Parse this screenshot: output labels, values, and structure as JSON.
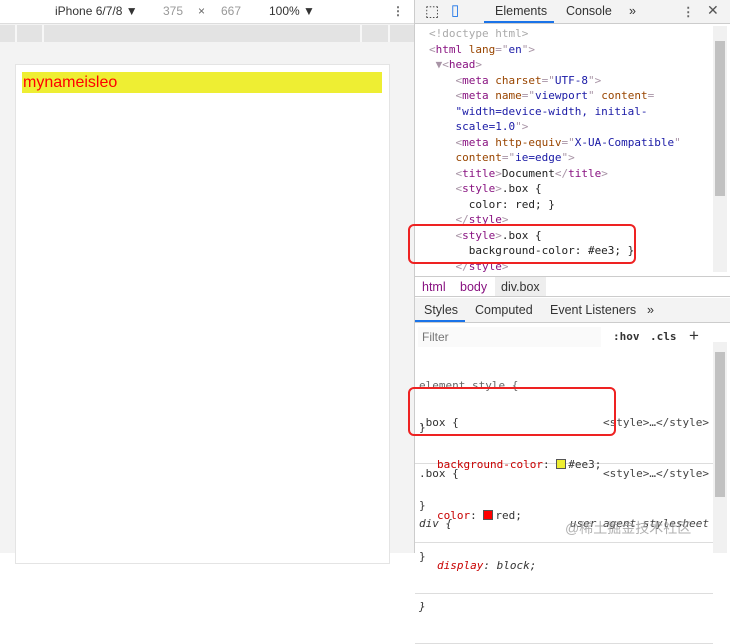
{
  "device_toolbar": {
    "device": "iPhone 6/7/8",
    "width": "375",
    "times": "×",
    "height": "667",
    "zoom": "100%"
  },
  "page": {
    "box_text": "mynameisleo",
    "box_bg": "#eeee33",
    "box_color": "#ff0000"
  },
  "devtools": {
    "tabs": [
      "Elements",
      "Console"
    ],
    "more": "»",
    "tree": [
      [
        [
          "gr",
          "<!doctype html>"
        ]
      ],
      [
        [
          "pn",
          "<"
        ],
        [
          "tg",
          "html"
        ],
        [
          "at",
          " lang"
        ],
        [
          "pn",
          "=\""
        ],
        [
          "av",
          "en"
        ],
        [
          "pn",
          "\">"
        ]
      ],
      [
        [
          "pn",
          " ▼<"
        ],
        [
          "tg",
          "head"
        ],
        [
          "pn",
          ">"
        ]
      ],
      [
        [
          "pn",
          "    <"
        ],
        [
          "tg",
          "meta"
        ],
        [
          "at",
          " charset"
        ],
        [
          "pn",
          "=\""
        ],
        [
          "av",
          "UTF-8"
        ],
        [
          "pn",
          "\">"
        ]
      ],
      [
        [
          "pn",
          "    <"
        ],
        [
          "tg",
          "meta"
        ],
        [
          "at",
          " name"
        ],
        [
          "pn",
          "=\""
        ],
        [
          "av",
          "viewport"
        ],
        [
          "pn",
          "\""
        ],
        [
          "at",
          " content"
        ],
        [
          "pn",
          "="
        ]
      ],
      [
        [
          "av",
          "    \"width=device-width, initial-"
        ]
      ],
      [
        [
          "av",
          "    scale=1.0"
        ],
        [
          "pn",
          "\">"
        ]
      ],
      [
        [
          "pn",
          "    <"
        ],
        [
          "tg",
          "meta"
        ],
        [
          "at",
          " http-equiv"
        ],
        [
          "pn",
          "=\""
        ],
        [
          "av",
          "X-UA-Compatible"
        ],
        [
          "pn",
          "\""
        ]
      ],
      [
        [
          "at",
          "    content"
        ],
        [
          "pn",
          "=\""
        ],
        [
          "av",
          "ie=edge"
        ],
        [
          "pn",
          "\">"
        ]
      ],
      [
        [
          "pn",
          "    <"
        ],
        [
          "tg",
          "title"
        ],
        [
          "pn",
          ">"
        ],
        [
          "tx",
          "Document"
        ],
        [
          "pn",
          "</"
        ],
        [
          "tg",
          "title"
        ],
        [
          "pn",
          ">"
        ]
      ],
      [
        [
          "pn",
          "    <"
        ],
        [
          "tg",
          "style"
        ],
        [
          "pn",
          ">"
        ],
        [
          "tx",
          ".box {"
        ]
      ],
      [
        [
          "tx",
          "      color: red; }"
        ]
      ],
      [
        [
          "pn",
          "    </"
        ],
        [
          "tg",
          "style"
        ],
        [
          "pn",
          ">"
        ]
      ],
      [
        [
          "pn",
          "    <"
        ],
        [
          "tg",
          "style"
        ],
        [
          "pn",
          ">"
        ],
        [
          "tx",
          ".box {"
        ]
      ],
      [
        [
          "tx",
          "      background-color: #ee3; }"
        ]
      ],
      [
        [
          "pn",
          "    </"
        ],
        [
          "tg",
          "style"
        ],
        [
          "pn",
          ">"
        ]
      ]
    ],
    "breadcrumb": [
      "html",
      "body",
      "div.box"
    ],
    "style_tabs": [
      "Styles",
      "Computed",
      "Event Listeners"
    ],
    "filter_placeholder": "Filter",
    "hov": ":hov",
    "cls": ".cls",
    "plus": "+",
    "rules": {
      "element": {
        "selector": "element.style {",
        "close": "}"
      },
      "box1": {
        "selector": ".box {",
        "source": "<style>…</style>",
        "prop": "background-color",
        "value": "#ee3;",
        "swatch": "#eeee33",
        "close": "}"
      },
      "box2": {
        "selector": ".box {",
        "source": "<style>…</style>",
        "prop": "color",
        "value": "red;",
        "swatch": "#ff0000",
        "close": "}"
      },
      "div": {
        "selector": "div {",
        "source": "user agent stylesheet",
        "prop": "display",
        "value": "block;",
        "close": "}"
      }
    },
    "watermark": "@稀土掘金技术社区"
  }
}
